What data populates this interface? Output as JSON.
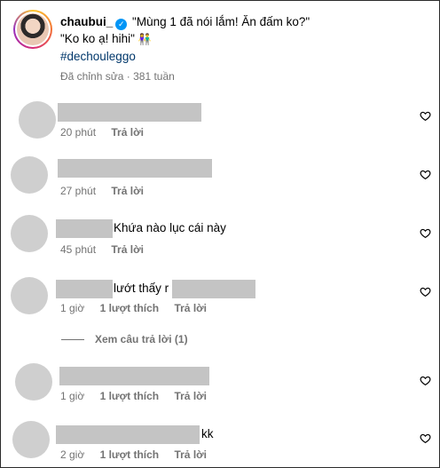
{
  "post": {
    "username": "chaubui_",
    "caption_line1": "\"Mùng 1 đã nói lắm! Ăn đấm ko?\"",
    "caption_line2": "\"Ko ko ạ! hihi\"",
    "caption_emoji": "👫",
    "hashtag": "#dechouleggo",
    "edited_label": "Đã chỉnh sửa",
    "separator": "·",
    "age": "381 tuần"
  },
  "comments": [
    {
      "text": "",
      "time": "20 phút",
      "likes": "",
      "reply": "Trả lời"
    },
    {
      "text": "",
      "time": "27 phút",
      "likes": "",
      "reply": "Trả lời"
    },
    {
      "text": "Khứa nào lục cái này",
      "time": "45 phút",
      "likes": "",
      "reply": "Trả lời"
    },
    {
      "text": "lướt thấy r",
      "time": "1 giờ",
      "likes": "1 lượt thích",
      "reply": "Trả lời",
      "view_replies": "Xem câu trả lời (1)"
    },
    {
      "text": "",
      "time": "1 giờ",
      "likes": "1 lượt thích",
      "reply": "Trả lời"
    },
    {
      "text": "kk",
      "time": "2 giờ",
      "likes": "1 lượt thích",
      "reply": "Trả lời"
    }
  ],
  "icons": {
    "like": "heart-outline-icon",
    "verified": "verified-badge-icon"
  },
  "colors": {
    "meta": "#737373",
    "hashtag": "#00376b",
    "verified": "#0095f6",
    "redaction": "#c4c4c4",
    "avatar_placeholder": "#cfcfcf"
  }
}
